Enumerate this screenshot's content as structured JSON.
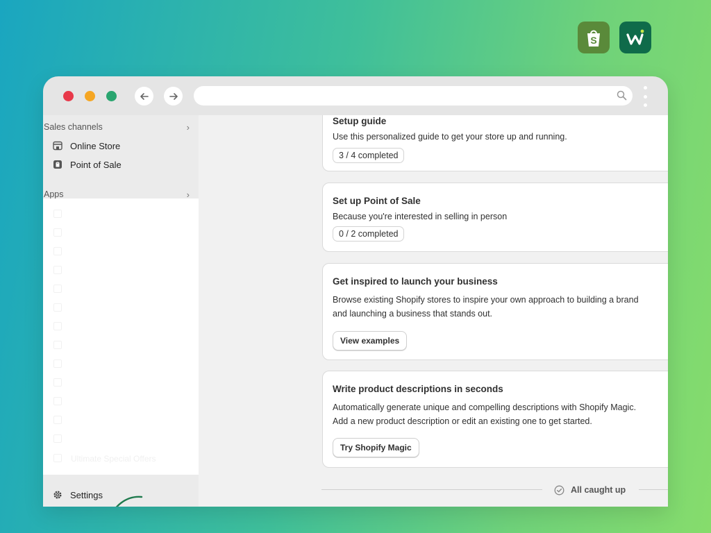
{
  "brand": {
    "accent_shopify": "#5a8a3a",
    "accent_w": "#0f6b4a"
  },
  "window": {
    "traffic_lights": {
      "close": "#e8394a",
      "minimize": "#f5a623",
      "maximize": "#29a56f"
    },
    "nav_icons": [
      "arrow-left-icon",
      "arrow-right-icon"
    ],
    "url": {
      "value": "",
      "placeholder": ""
    }
  },
  "sidebar": {
    "sales_channels": {
      "heading": "Sales channels",
      "items": [
        {
          "label": "Online Store",
          "icon": "storefront-icon"
        },
        {
          "label": "Point of Sale",
          "icon": "pos-icon"
        }
      ]
    },
    "apps": {
      "heading": "Apps",
      "faded_item": "Ultimate Special Offers"
    },
    "settings_label": "Settings"
  },
  "cards": [
    {
      "title": "Setup guide",
      "description": [
        "Use this personalized guide to get your store up and running."
      ],
      "badge": "3 / 4 completed"
    },
    {
      "title": "Set up Point of Sale",
      "description": [
        "Because you're interested in selling in person"
      ],
      "badge": "0 / 2 completed"
    },
    {
      "title": "Get inspired to launch your business",
      "description": [
        "Browse existing Shopify stores to inspire your own approach to building a brand",
        "and launching a business that stands out."
      ],
      "button": "View examples"
    },
    {
      "title": "Write product descriptions in seconds",
      "description": [
        "Automatically generate unique and compelling descriptions with Shopify Magic.",
        "Add a new product description or edit an existing one to get started."
      ],
      "button": "Try Shopify Magic"
    }
  ],
  "footer": {
    "caught_up": "All caught up"
  }
}
